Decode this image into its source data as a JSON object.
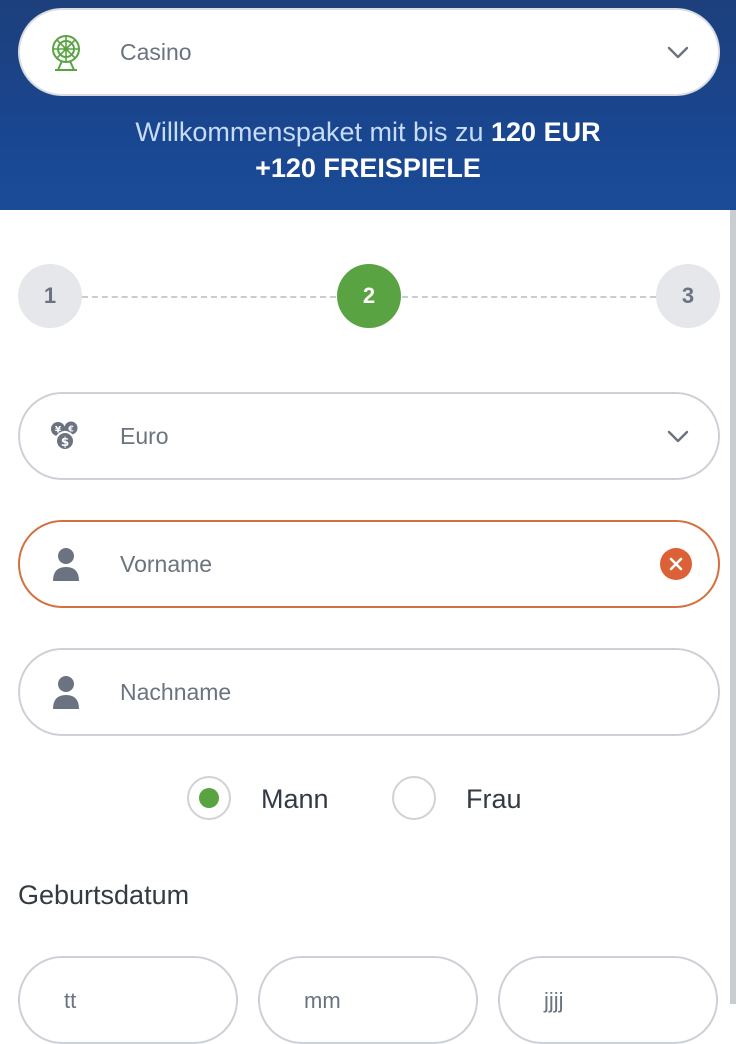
{
  "product_select": {
    "icon": "roulette-wheel-icon",
    "value": "Casino"
  },
  "promo": {
    "line1_prefix": "Willkommenspaket mit bis zu ",
    "line1_bold": "120 EUR",
    "line2_bold": "+120 FREISPIELE"
  },
  "steps": {
    "step1": "1",
    "step2": "2",
    "step3": "3",
    "active_step": 2
  },
  "currency": {
    "icon": "currency-coins-icon",
    "value": "Euro"
  },
  "first_name": {
    "placeholder": "Vorname",
    "state": "error"
  },
  "last_name": {
    "placeholder": "Nachname"
  },
  "gender": {
    "male_label": "Mann",
    "female_label": "Frau",
    "selected": "Mann"
  },
  "birthdate": {
    "label": "Geburtsdatum",
    "day_placeholder": "tt",
    "month_placeholder": "mm",
    "year_placeholder": "jjjj"
  },
  "colors": {
    "header": "#1b4690",
    "accent_green": "#5aa342",
    "error_orange": "#dc6136"
  }
}
